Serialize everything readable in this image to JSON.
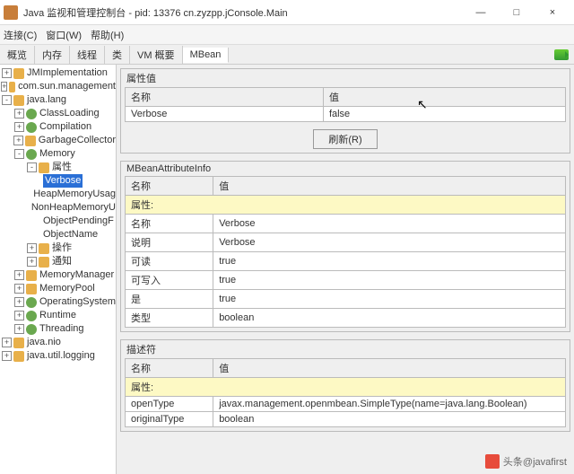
{
  "window": {
    "title": "Java 监视和管理控制台 - pid: 13376 cn.zyzpp.jConsole.Main",
    "min": "—",
    "max": "□",
    "close": "×"
  },
  "menus": {
    "connection": "连接(C)",
    "window": "窗口(W)",
    "help": "帮助(H)"
  },
  "tabs": {
    "overview": "概览",
    "memory": "内存",
    "threads": "线程",
    "classes": "类",
    "vm": "VM 概要",
    "mbeans": "MBean"
  },
  "tree": {
    "n0": "JMImplementation",
    "n1": "com.sun.management",
    "n2": "java.lang",
    "n2_0": "ClassLoading",
    "n2_1": "Compilation",
    "n2_2": "GarbageCollector",
    "n2_3": "Memory",
    "n2_3_0": "属性",
    "n2_3_0_0": "Verbose",
    "n2_3_0_1": "HeapMemoryUsag",
    "n2_3_0_2": "NonHeapMemoryU",
    "n2_3_0_3": "ObjectPendingF",
    "n2_3_0_4": "ObjectName",
    "n2_3_1": "操作",
    "n2_3_2": "通知",
    "n2_4": "MemoryManager",
    "n2_5": "MemoryPool",
    "n2_6": "OperatingSystem",
    "n2_7": "Runtime",
    "n2_8": "Threading",
    "n3": "java.nio",
    "n4": "java.util.logging"
  },
  "attrValue": {
    "panelTitle": "属性值",
    "colName": "名称",
    "colVal": "值",
    "rowName": "Verbose",
    "rowVal": "false",
    "refresh": "刷新(R)"
  },
  "attrInfo": {
    "panelTitle": "MBeanAttributeInfo",
    "colName": "名称",
    "colVal": "值",
    "hl": "属性:",
    "r0n": "名称",
    "r0v": "Verbose",
    "r1n": "说明",
    "r1v": "Verbose",
    "r2n": "可读",
    "r2v": "true",
    "r3n": "可写入",
    "r3v": "true",
    "r4n": "是",
    "r4v": "true",
    "r5n": "类型",
    "r5v": "boolean"
  },
  "descriptor": {
    "panelTitle": "描述符",
    "colName": "名称",
    "colVal": "值",
    "hl": "属性:",
    "r0n": "openType",
    "r0v": "javax.management.openmbean.SimpleType(name=java.lang.Boolean)",
    "r1n": "originalType",
    "r1v": "boolean"
  },
  "watermark": "头条@javafirst"
}
